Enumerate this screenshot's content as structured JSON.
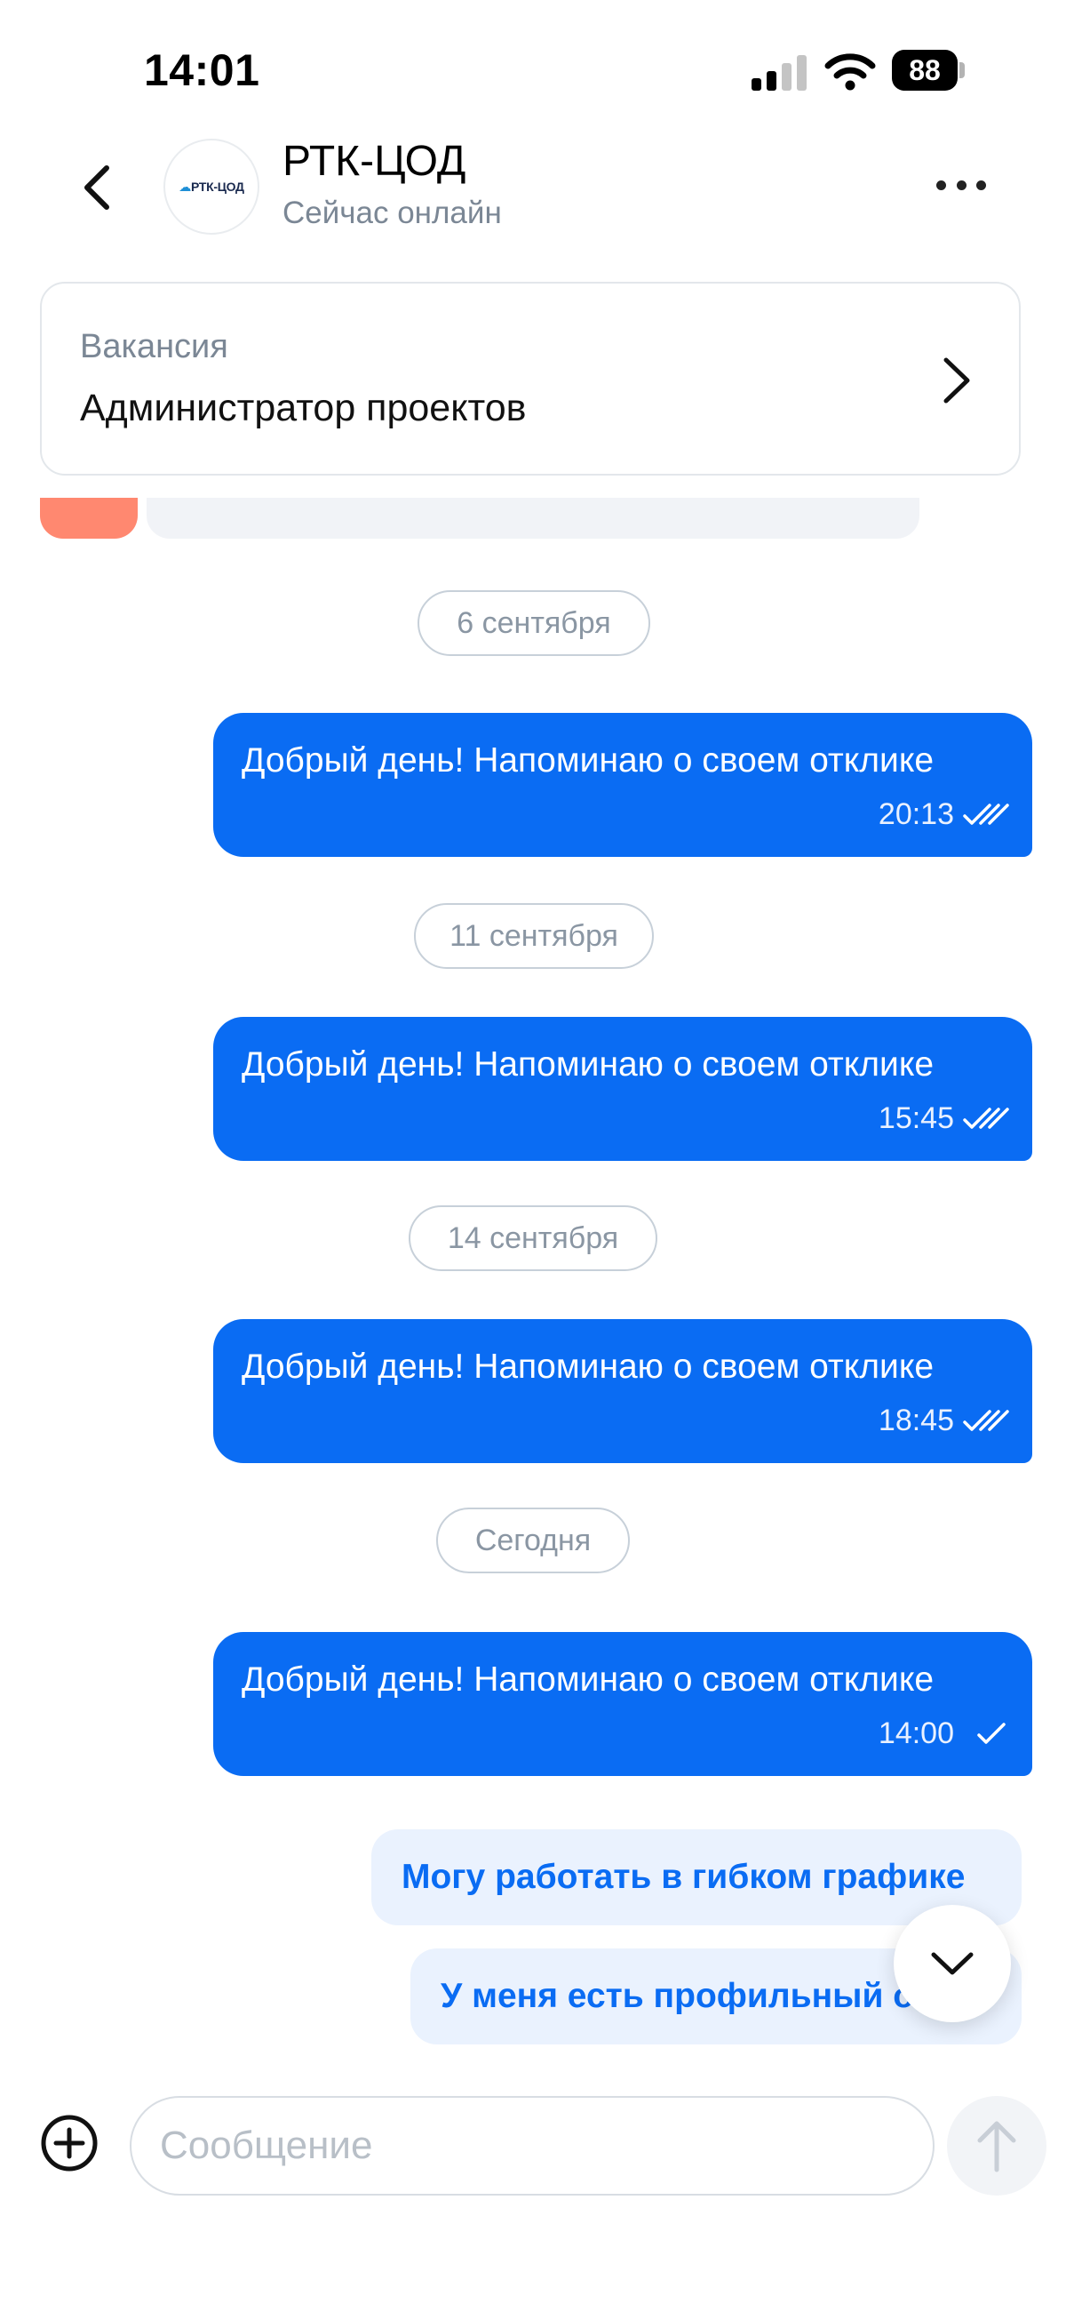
{
  "status_bar": {
    "time": "14:01",
    "battery": "88"
  },
  "header": {
    "title": "РТК-ЦОД",
    "subtitle": "Сейчас онлайн",
    "avatar_text": "РТК-ЦОД"
  },
  "vacancy": {
    "label": "Вакансия",
    "title": "Администратор проектов"
  },
  "messages": [
    {
      "date": "6 сентября",
      "text": "Добрый день! Напоминаю о своем отклике",
      "time": "20:13",
      "status": "read"
    },
    {
      "date": "11 сентября",
      "text": "Добрый день! Напоминаю о своем отклике",
      "time": "15:45",
      "status": "read"
    },
    {
      "date": "14 сентября",
      "text": "Добрый день! Напоминаю о своем отклике",
      "time": "18:45",
      "status": "read"
    },
    {
      "date": "Сегодня",
      "text": "Добрый день! Напоминаю о своем отклике",
      "time": "14:00",
      "status": "sent"
    }
  ],
  "quick_replies": [
    "Могу работать в гибком графике",
    "У меня есть профильный о"
  ],
  "composer": {
    "placeholder": "Сообщение"
  },
  "colors": {
    "accent": "#0a6cf3",
    "quick_bg": "#eaf2fe",
    "muted": "#7b8795"
  },
  "icons": {
    "back": "chevron-left-icon",
    "more": "more-horizontal-icon",
    "attach": "plus-circle-icon",
    "send": "arrow-up-icon",
    "scroll": "chevron-down-icon"
  }
}
